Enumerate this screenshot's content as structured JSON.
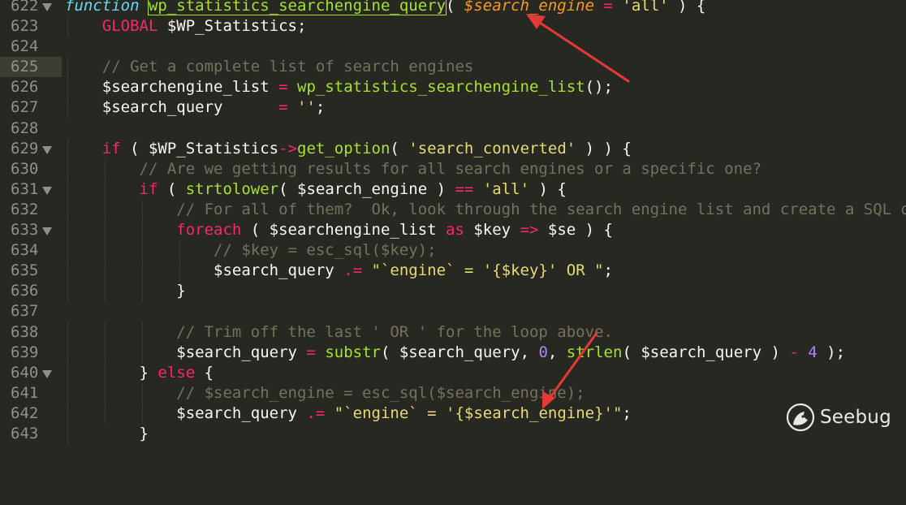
{
  "editor": {
    "current_line": "625",
    "lines": [
      {
        "n": "622",
        "fold": true
      },
      {
        "n": "623",
        "fold": false
      },
      {
        "n": "624",
        "fold": false
      },
      {
        "n": "625",
        "fold": false
      },
      {
        "n": "626",
        "fold": false
      },
      {
        "n": "627",
        "fold": false
      },
      {
        "n": "628",
        "fold": false
      },
      {
        "n": "629",
        "fold": true
      },
      {
        "n": "630",
        "fold": false
      },
      {
        "n": "631",
        "fold": true
      },
      {
        "n": "632",
        "fold": false
      },
      {
        "n": "633",
        "fold": true
      },
      {
        "n": "634",
        "fold": false
      },
      {
        "n": "635",
        "fold": false
      },
      {
        "n": "636",
        "fold": false
      },
      {
        "n": "637",
        "fold": false
      },
      {
        "n": "638",
        "fold": false
      },
      {
        "n": "639",
        "fold": false
      },
      {
        "n": "640",
        "fold": true
      },
      {
        "n": "641",
        "fold": false
      },
      {
        "n": "642",
        "fold": false
      },
      {
        "n": "643",
        "fold": false
      }
    ],
    "t": {
      "l622_kw": "function",
      "l622_fn": "wp_statistics_searchengine_query",
      "l622_p1": "( ",
      "l622_param": "$search_engine",
      "l622_eq": " = ",
      "l622_str": "'all'",
      "l622_p2": " ) {",
      "l623_kw": "GLOBAL",
      "l623_rest": " $WP_Statistics;",
      "l625_cm": "// Get a complete list of search engines",
      "l626_var": "$searchengine_list",
      "l626_eq": " = ",
      "l626_fn": "wp_statistics_searchengine_list",
      "l626_rest": "();",
      "l627_var": "$search_query      ",
      "l627_eq": "= ",
      "l627_str": "''",
      "l627_rest": ";",
      "l629_kw": "if",
      "l629_a": " ( $WP_Statistics",
      "l629_arrow": "->",
      "l629_fn": "get_option",
      "l629_b": "( ",
      "l629_str": "'search_converted'",
      "l629_c": " ) ) {",
      "l630_cm": "// Are we getting results for all search engines or a specific one?",
      "l631_kw": "if",
      "l631_a": " ( ",
      "l631_fn": "strtolower",
      "l631_b": "( $search_engine ) ",
      "l631_op": "==",
      "l631_c": " ",
      "l631_str": "'all'",
      "l631_d": " ) {",
      "l632_cm": "// For all of them?  Ok, look through the search engine list and create a SQL q",
      "l633_kw": "foreach",
      "l633_a": " ( $searchengine_list ",
      "l633_as": "as",
      "l633_b": " $key ",
      "l633_op": "=>",
      "l633_c": " $se ) {",
      "l634_cm": "// $key = esc_sql($key);",
      "l635_var": "$search_query ",
      "l635_op": ".=",
      "l635_sp": " ",
      "l635_str": "\"`engine` = '{$key}' OR \"",
      "l635_rest": ";",
      "l636": "}",
      "l638_cm": "// Trim off the last ' OR ' for the loop above.",
      "l639_var": "$search_query ",
      "l639_eq": "=",
      "l639_sp": " ",
      "l639_fn": "substr",
      "l639_a": "( $search_query, ",
      "l639_n0": "0",
      "l639_b": ", ",
      "l639_fn2": "strlen",
      "l639_c": "( $search_query ) ",
      "l639_minus": "-",
      "l639_d": " ",
      "l639_n4": "4",
      "l639_e": " );",
      "l640_a": "} ",
      "l640_kw": "else",
      "l640_b": " {",
      "l641_cm": "// $search_engine = esc_sql($search_engine);",
      "l642_var": "$search_query ",
      "l642_op": ".=",
      "l642_sp": " ",
      "l642_str": "\"`engine` = '{$search_engine}'\"",
      "l642_rest": ";",
      "l643": "}"
    }
  },
  "watermark": {
    "text": "Seebug",
    "icon": "seebug-logo-icon"
  },
  "colors": {
    "background": "#272822",
    "gutter_text": "#90908a",
    "keyword": "#f92672",
    "function": "#a6e22e",
    "string": "#e6db74",
    "comment": "#75715e",
    "number": "#ae81ff",
    "parameter": "#fd971f",
    "annotation_arrow": "#e53935"
  }
}
